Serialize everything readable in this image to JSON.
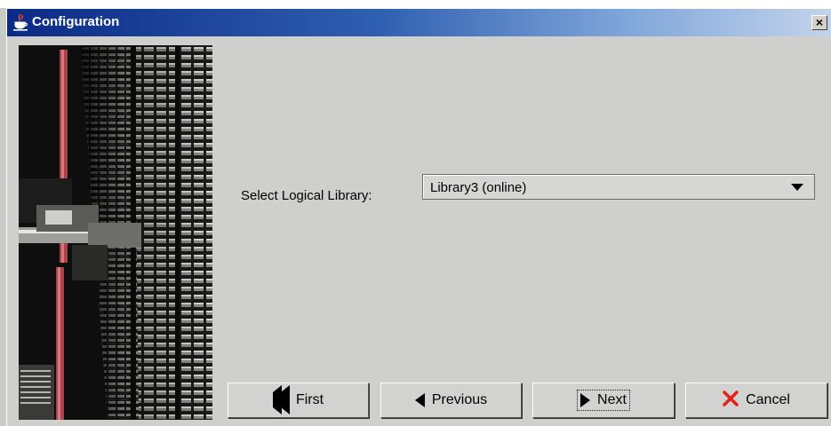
{
  "window": {
    "title": "Configuration",
    "close_symbol": "×",
    "title_icon": "java-cup-icon",
    "titlebar_colors": [
      "#0b2a86",
      "#c3d3ea"
    ]
  },
  "photo": {
    "description_icon": "tape-library-photo"
  },
  "form": {
    "library_label": "Select Logical Library:",
    "library_selected": "Library3 (online)"
  },
  "buttons": {
    "first": "First",
    "previous": "Previous",
    "next": "Next",
    "cancel": "Cancel"
  },
  "colors": {
    "cancel_icon": "#e0221b",
    "background": "#cfcfcd"
  }
}
